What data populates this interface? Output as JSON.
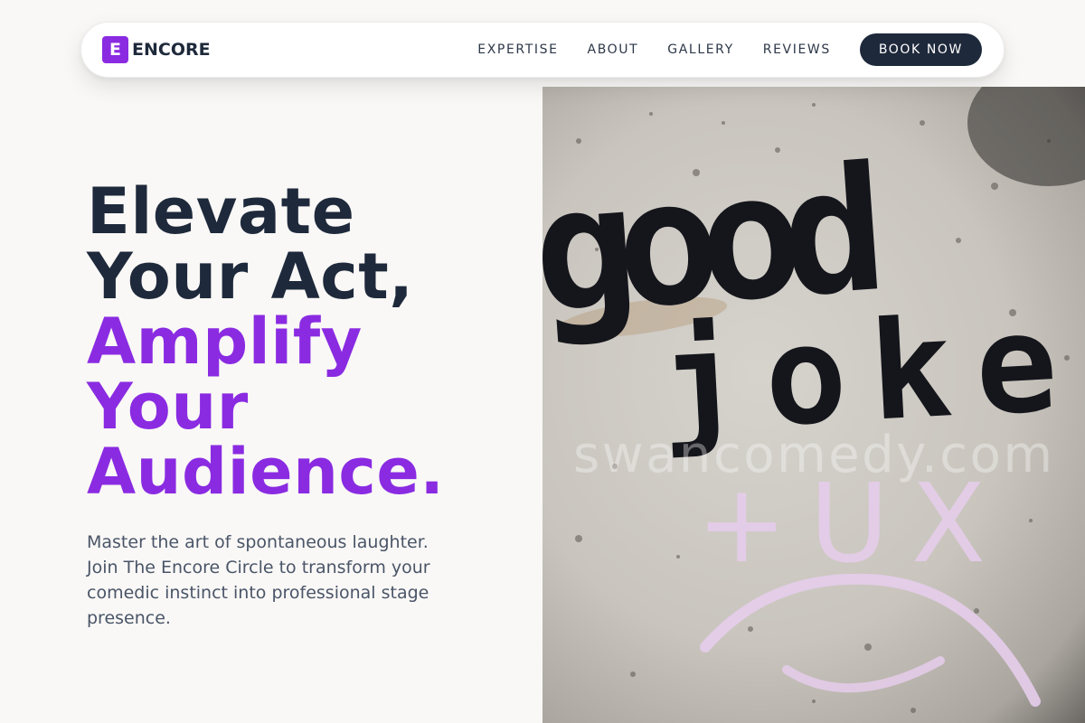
{
  "brand": {
    "logo_letter": "E",
    "name": "ENCORE"
  },
  "nav": {
    "links": [
      "EXPERTISE",
      "ABOUT",
      "GALLERY",
      "REVIEWS"
    ],
    "cta_label": "BOOK NOW"
  },
  "hero": {
    "headline_lines": [
      "Elevate",
      "Your Act,"
    ],
    "headline_accent_lines": [
      "Amplify",
      "Your",
      "Audience."
    ],
    "subtext": "Master the art of spontaneous laughter. Join The Encore Circle to transform your comedic instinct into professional stage presence."
  },
  "image": {
    "graffiti_line1": "good",
    "graffiti_line2": "joke",
    "chalk_text": "+UX",
    "watermark": "swancomedy.com"
  },
  "colors": {
    "accent": "#8a2be2",
    "dark": "#1e293b",
    "button": "#1e293b",
    "body_text": "#4a5568"
  },
  "icons": {
    "logo": "letter-e-logo-icon"
  }
}
